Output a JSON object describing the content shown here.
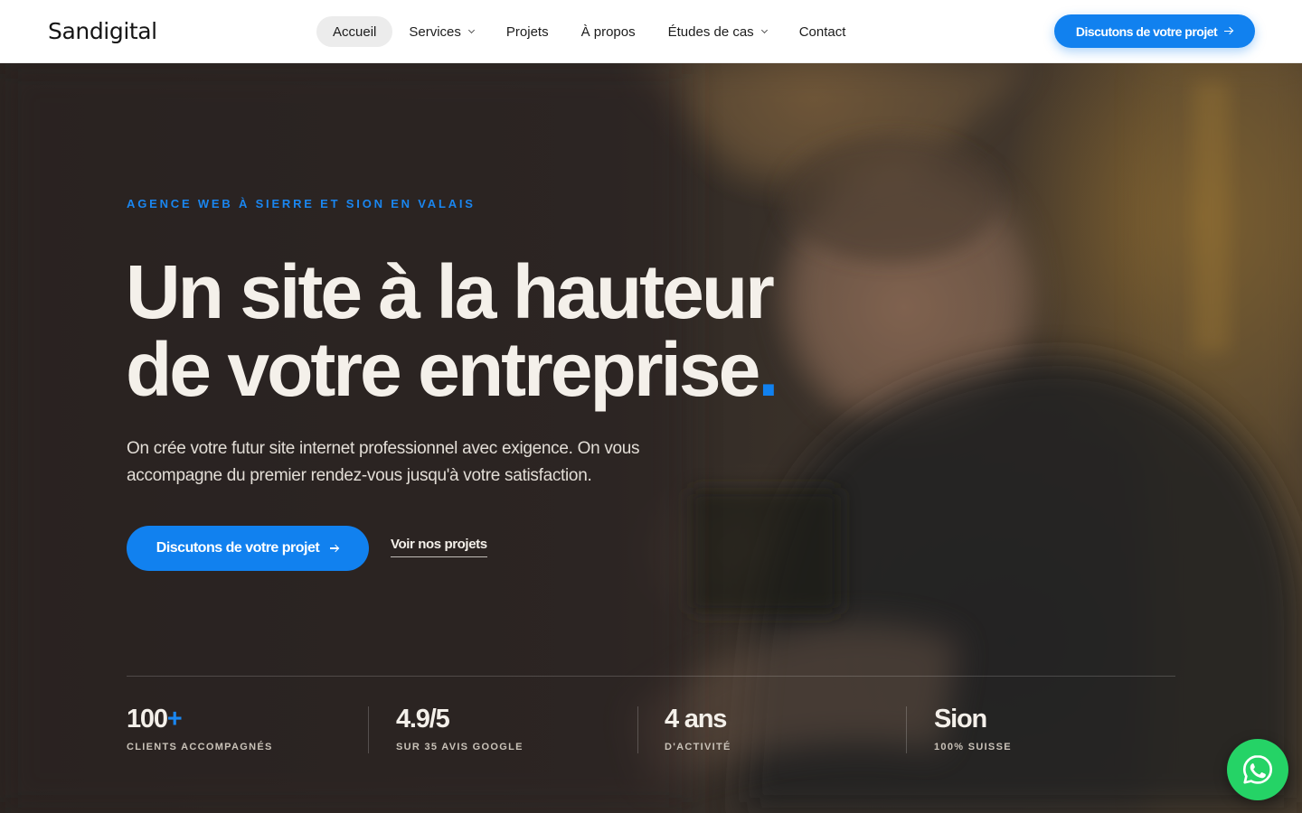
{
  "brand": {
    "name": "Sandigital",
    "accent": "#1181ef"
  },
  "nav": {
    "items": [
      {
        "label": "Accueil",
        "active": true,
        "dropdown": false
      },
      {
        "label": "Services",
        "active": false,
        "dropdown": true
      },
      {
        "label": "Projets",
        "active": false,
        "dropdown": false
      },
      {
        "label": "À propos",
        "active": false,
        "dropdown": false
      },
      {
        "label": "Études de cas",
        "active": false,
        "dropdown": true
      },
      {
        "label": "Contact",
        "active": false,
        "dropdown": false
      }
    ],
    "cta_label": "Discutons de votre projet"
  },
  "hero": {
    "eyebrow": "AGENCE WEB À SIERRE ET SION EN VALAIS",
    "headline_line1": "Un site à la hauteur",
    "headline_line2": "de votre entreprise",
    "headline_dot": ".",
    "subtext": "On crée votre futur site internet professionnel avec exigence. On vous accompagne du premier rendez-vous jusqu'à votre satisfaction.",
    "cta_label": "Discutons de votre projet",
    "secondary_link": "Voir nos projets"
  },
  "stats": [
    {
      "value": "100",
      "suffix": "+",
      "label": "CLIENTS ACCOMPAGNÉS"
    },
    {
      "value": "4.9/5",
      "suffix": "",
      "label": "SUR 35 AVIS GOOGLE"
    },
    {
      "value": "4 ans",
      "suffix": "",
      "label": "D'ACTIVITÉ"
    },
    {
      "value": "Sion",
      "suffix": "",
      "label": "100% SUISSE"
    }
  ],
  "icons": {
    "whatsapp": "whatsapp-icon",
    "arrow": "arrow-right-icon",
    "dropdown": "chevron-down-icon"
  },
  "colors": {
    "whatsapp": "#25d366",
    "eyebrow": "#1a86f0",
    "background_dark": "#2b2521"
  }
}
